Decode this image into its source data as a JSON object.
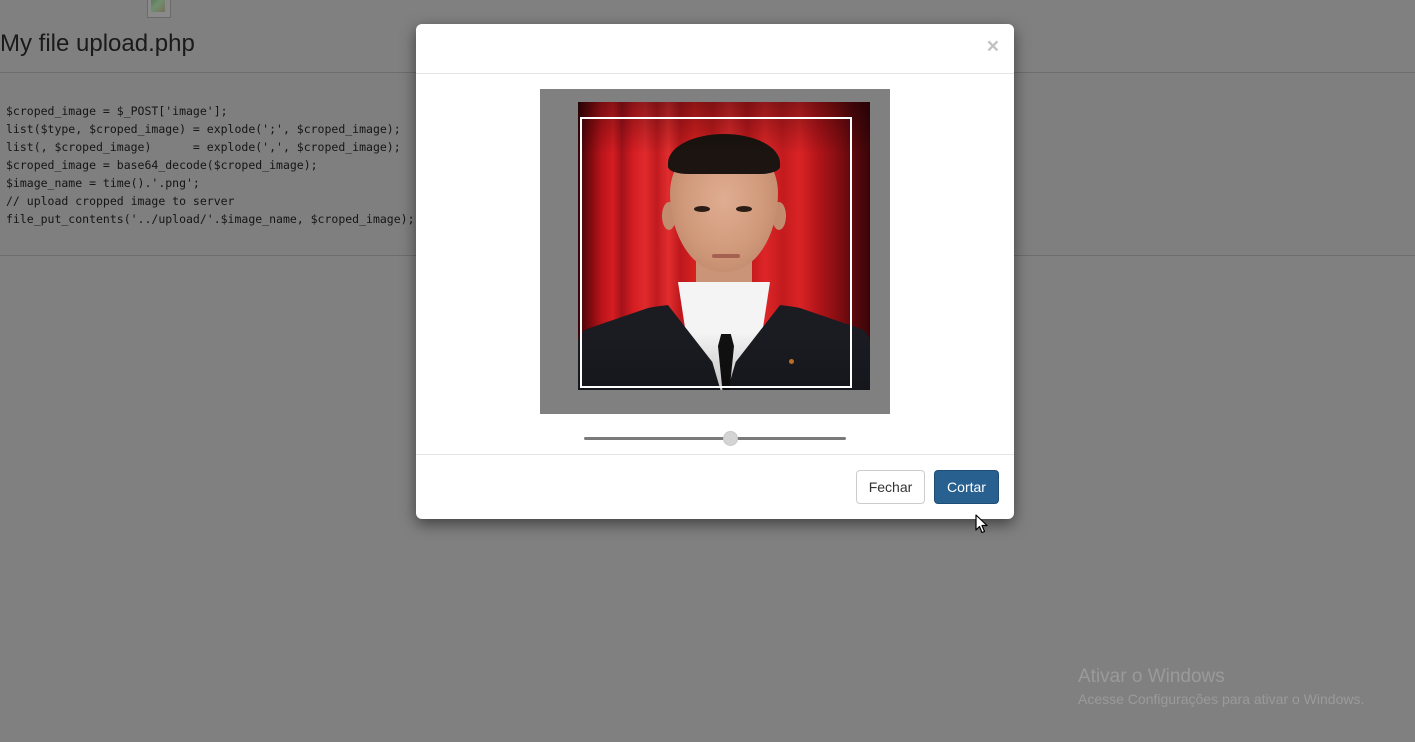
{
  "page": {
    "title": "My file upload.php",
    "broken_image_icon": "broken-image-icon"
  },
  "code": {
    "lines": [
      "$croped_image = $_POST['image'];",
      "list($type, $croped_image) = explode(';', $croped_image);",
      "list(, $croped_image)      = explode(',', $croped_image);",
      "$croped_image = base64_decode($croped_image);",
      "$image_name = time().'.png';",
      "// upload cropped image to server",
      "file_put_contents('../upload/'.$image_name, $croped_image);"
    ]
  },
  "modal": {
    "close_label": "×",
    "image_alt": "Cropping preview of a portrait photo",
    "zoom_level": 0.56,
    "buttons": {
      "close": "Fechar",
      "crop": "Cortar"
    },
    "colors": {
      "primary": "#286090",
      "backdrop": "#808080"
    }
  },
  "watermark": {
    "title": "Ativar o Windows",
    "subtitle": "Acesse Configurações para ativar o Windows."
  }
}
